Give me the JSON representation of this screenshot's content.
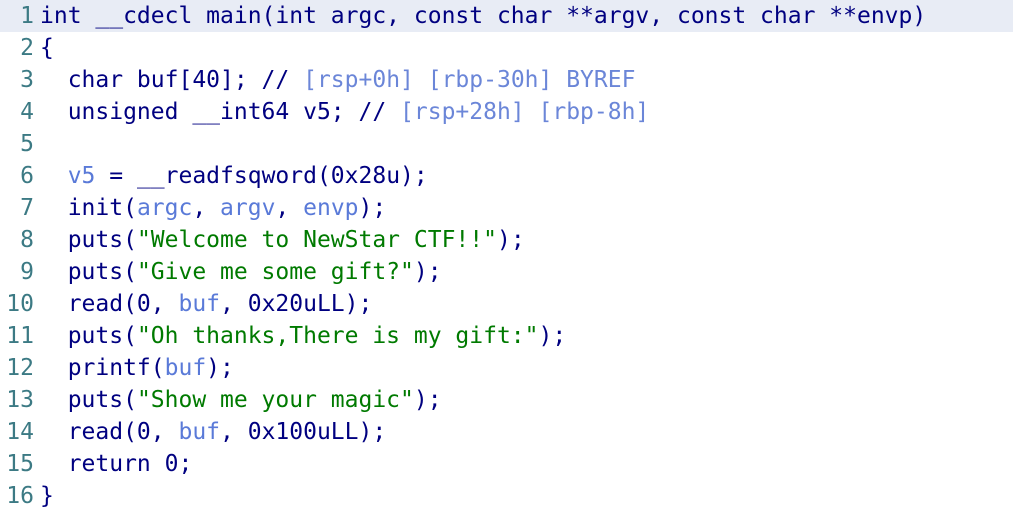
{
  "editor": {
    "lines": [
      {
        "num": "1",
        "current": true,
        "tokens": [
          {
            "t": "int __cdecl main(int argc, const char **argv, const char **envp)",
            "c": "t-code"
          }
        ]
      },
      {
        "num": "2",
        "tokens": [
          {
            "t": "{",
            "c": "t-code"
          }
        ]
      },
      {
        "num": "3",
        "tokens": [
          {
            "t": "  char buf[40]; // ",
            "c": "t-code"
          },
          {
            "t": "[rsp+0h] [rbp-30h]",
            "c": "t-cmt-addr"
          },
          {
            "t": " BYREF",
            "c": "t-cmt-addr"
          }
        ]
      },
      {
        "num": "4",
        "tokens": [
          {
            "t": "  unsigned __int64 v5; // ",
            "c": "t-code"
          },
          {
            "t": "[rsp+28h] [rbp-8h]",
            "c": "t-cmt-addr"
          }
        ]
      },
      {
        "num": "5",
        "tokens": []
      },
      {
        "num": "6",
        "tokens": [
          {
            "t": "  ",
            "c": "t-code"
          },
          {
            "t": "v5",
            "c": "t-blue"
          },
          {
            "t": " = __readfsqword(0x28u);",
            "c": "t-code"
          }
        ]
      },
      {
        "num": "7",
        "tokens": [
          {
            "t": "  init(",
            "c": "t-code"
          },
          {
            "t": "argc",
            "c": "t-blue"
          },
          {
            "t": ", ",
            "c": "t-code"
          },
          {
            "t": "argv",
            "c": "t-blue"
          },
          {
            "t": ", ",
            "c": "t-code"
          },
          {
            "t": "envp",
            "c": "t-blue"
          },
          {
            "t": ");",
            "c": "t-code"
          }
        ]
      },
      {
        "num": "8",
        "tokens": [
          {
            "t": "  puts(",
            "c": "t-code"
          },
          {
            "t": "\"Welcome to NewStar CTF!!\"",
            "c": "t-str"
          },
          {
            "t": ");",
            "c": "t-code"
          }
        ]
      },
      {
        "num": "9",
        "tokens": [
          {
            "t": "  puts(",
            "c": "t-code"
          },
          {
            "t": "\"Give me some gift?\"",
            "c": "t-str"
          },
          {
            "t": ");",
            "c": "t-code"
          }
        ]
      },
      {
        "num": "10",
        "tokens": [
          {
            "t": "  read(0, ",
            "c": "t-code"
          },
          {
            "t": "buf",
            "c": "t-blue"
          },
          {
            "t": ", 0x20uLL);",
            "c": "t-code"
          }
        ]
      },
      {
        "num": "11",
        "tokens": [
          {
            "t": "  puts(",
            "c": "t-code"
          },
          {
            "t": "\"Oh thanks,There is my gift:\"",
            "c": "t-str"
          },
          {
            "t": ");",
            "c": "t-code"
          }
        ]
      },
      {
        "num": "12",
        "tokens": [
          {
            "t": "  printf(",
            "c": "t-code"
          },
          {
            "t": "buf",
            "c": "t-blue"
          },
          {
            "t": ");",
            "c": "t-code"
          }
        ]
      },
      {
        "num": "13",
        "tokens": [
          {
            "t": "  puts(",
            "c": "t-code"
          },
          {
            "t": "\"Show me your magic\"",
            "c": "t-str"
          },
          {
            "t": ");",
            "c": "t-code"
          }
        ]
      },
      {
        "num": "14",
        "tokens": [
          {
            "t": "  read(0, ",
            "c": "t-code"
          },
          {
            "t": "buf",
            "c": "t-blue"
          },
          {
            "t": ", 0x100uLL);",
            "c": "t-code"
          }
        ]
      },
      {
        "num": "15",
        "tokens": [
          {
            "t": "  return 0;",
            "c": "t-code"
          }
        ]
      },
      {
        "num": "16",
        "tokens": [
          {
            "t": "}",
            "c": "t-code"
          }
        ]
      }
    ]
  },
  "colors": {
    "code_text": "#000080",
    "identifier": "#5a7ad8",
    "string_literal": "#007a00",
    "line_number": "#3c7a84",
    "current_line_bg": "#e8ecf5",
    "background": "#ffffff"
  }
}
